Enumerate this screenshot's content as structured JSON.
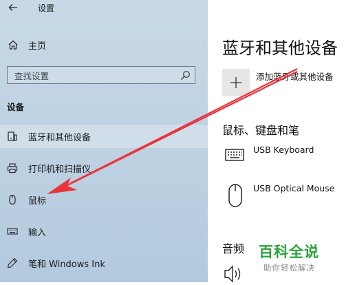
{
  "window": {
    "title": "设置"
  },
  "sidebar": {
    "home_label": "主页",
    "search": {
      "placeholder": "查找设置"
    },
    "section_label": "设备",
    "items": [
      {
        "label": "蓝牙和其他设备",
        "icon": "bluetooth-devices-icon",
        "selected": true
      },
      {
        "label": "打印机和扫描仪",
        "icon": "printer-icon",
        "selected": false
      },
      {
        "label": "鼠标",
        "icon": "mouse-icon",
        "selected": false
      },
      {
        "label": "输入",
        "icon": "keyboard-icon",
        "selected": false
      },
      {
        "label": "笔和 Windows Ink",
        "icon": "pen-icon",
        "selected": false
      }
    ]
  },
  "main": {
    "title": "蓝牙和其他设备",
    "add_device_label": "添加蓝牙或其他设备",
    "mouse_keyboard_section": "鼠标、键盘和笔",
    "devices": [
      {
        "name": "USB Keyboard",
        "icon": "keyboard-device-icon"
      },
      {
        "name": "USB Optical Mouse",
        "icon": "mouse-device-icon"
      }
    ],
    "audio_section": "音频"
  },
  "watermark": {
    "main": "百科全说",
    "sub": "助你轻松解决"
  },
  "colors": {
    "sidebar_bg": "#c2d5e3",
    "annotation_arrow": "#e8343a",
    "watermark": "#2aa33a"
  }
}
